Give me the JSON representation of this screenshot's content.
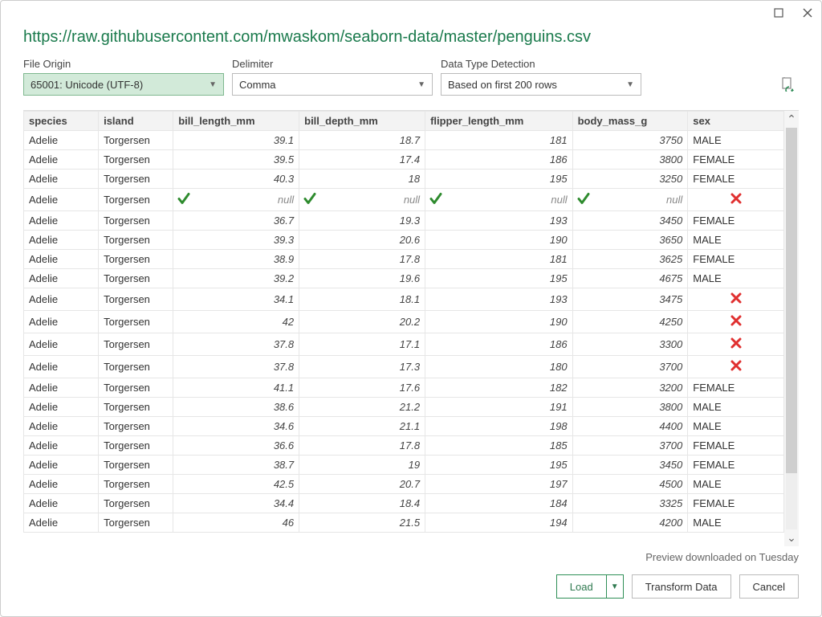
{
  "titlebar": {
    "maximize_icon": "maximize",
    "close_icon": "close"
  },
  "url": "https://raw.githubusercontent.com/mwaskom/seaborn-data/master/penguins.csv",
  "options": {
    "file_origin_label": "File Origin",
    "file_origin_value": "65001: Unicode (UTF-8)",
    "delimiter_label": "Delimiter",
    "delimiter_value": "Comma",
    "detection_label": "Data Type Detection",
    "detection_value": "Based on first 200 rows"
  },
  "columns": [
    "species",
    "island",
    "bill_length_mm",
    "bill_depth_mm",
    "flipper_length_mm",
    "body_mass_g",
    "sex"
  ],
  "null_label": "null",
  "rows": [
    {
      "species": "Adelie",
      "island": "Torgersen",
      "bill_length_mm": "39.1",
      "bill_depth_mm": "18.7",
      "flipper_length_mm": "181",
      "body_mass_g": "3750",
      "sex": "MALE",
      "marks": {}
    },
    {
      "species": "Adelie",
      "island": "Torgersen",
      "bill_length_mm": "39.5",
      "bill_depth_mm": "17.4",
      "flipper_length_mm": "186",
      "body_mass_g": "3800",
      "sex": "FEMALE",
      "marks": {}
    },
    {
      "species": "Adelie",
      "island": "Torgersen",
      "bill_length_mm": "40.3",
      "bill_depth_mm": "18",
      "flipper_length_mm": "195",
      "body_mass_g": "3250",
      "sex": "FEMALE",
      "marks": {}
    },
    {
      "species": "Adelie",
      "island": "Torgersen",
      "bill_length_mm": null,
      "bill_depth_mm": null,
      "flipper_length_mm": null,
      "body_mass_g": null,
      "sex": null,
      "marks": {
        "bill_length_mm": "check",
        "bill_depth_mm": "check",
        "flipper_length_mm": "check",
        "body_mass_g": "check",
        "sex": "x"
      }
    },
    {
      "species": "Adelie",
      "island": "Torgersen",
      "bill_length_mm": "36.7",
      "bill_depth_mm": "19.3",
      "flipper_length_mm": "193",
      "body_mass_g": "3450",
      "sex": "FEMALE",
      "marks": {}
    },
    {
      "species": "Adelie",
      "island": "Torgersen",
      "bill_length_mm": "39.3",
      "bill_depth_mm": "20.6",
      "flipper_length_mm": "190",
      "body_mass_g": "3650",
      "sex": "MALE",
      "marks": {}
    },
    {
      "species": "Adelie",
      "island": "Torgersen",
      "bill_length_mm": "38.9",
      "bill_depth_mm": "17.8",
      "flipper_length_mm": "181",
      "body_mass_g": "3625",
      "sex": "FEMALE",
      "marks": {}
    },
    {
      "species": "Adelie",
      "island": "Torgersen",
      "bill_length_mm": "39.2",
      "bill_depth_mm": "19.6",
      "flipper_length_mm": "195",
      "body_mass_g": "4675",
      "sex": "MALE",
      "marks": {}
    },
    {
      "species": "Adelie",
      "island": "Torgersen",
      "bill_length_mm": "34.1",
      "bill_depth_mm": "18.1",
      "flipper_length_mm": "193",
      "body_mass_g": "3475",
      "sex": null,
      "marks": {
        "sex": "x"
      }
    },
    {
      "species": "Adelie",
      "island": "Torgersen",
      "bill_length_mm": "42",
      "bill_depth_mm": "20.2",
      "flipper_length_mm": "190",
      "body_mass_g": "4250",
      "sex": null,
      "marks": {
        "sex": "x"
      }
    },
    {
      "species": "Adelie",
      "island": "Torgersen",
      "bill_length_mm": "37.8",
      "bill_depth_mm": "17.1",
      "flipper_length_mm": "186",
      "body_mass_g": "3300",
      "sex": null,
      "marks": {
        "sex": "x"
      }
    },
    {
      "species": "Adelie",
      "island": "Torgersen",
      "bill_length_mm": "37.8",
      "bill_depth_mm": "17.3",
      "flipper_length_mm": "180",
      "body_mass_g": "3700",
      "sex": null,
      "marks": {
        "sex": "x"
      }
    },
    {
      "species": "Adelie",
      "island": "Torgersen",
      "bill_length_mm": "41.1",
      "bill_depth_mm": "17.6",
      "flipper_length_mm": "182",
      "body_mass_g": "3200",
      "sex": "FEMALE",
      "marks": {}
    },
    {
      "species": "Adelie",
      "island": "Torgersen",
      "bill_length_mm": "38.6",
      "bill_depth_mm": "21.2",
      "flipper_length_mm": "191",
      "body_mass_g": "3800",
      "sex": "MALE",
      "marks": {}
    },
    {
      "species": "Adelie",
      "island": "Torgersen",
      "bill_length_mm": "34.6",
      "bill_depth_mm": "21.1",
      "flipper_length_mm": "198",
      "body_mass_g": "4400",
      "sex": "MALE",
      "marks": {}
    },
    {
      "species": "Adelie",
      "island": "Torgersen",
      "bill_length_mm": "36.6",
      "bill_depth_mm": "17.8",
      "flipper_length_mm": "185",
      "body_mass_g": "3700",
      "sex": "FEMALE",
      "marks": {}
    },
    {
      "species": "Adelie",
      "island": "Torgersen",
      "bill_length_mm": "38.7",
      "bill_depth_mm": "19",
      "flipper_length_mm": "195",
      "body_mass_g": "3450",
      "sex": "FEMALE",
      "marks": {}
    },
    {
      "species": "Adelie",
      "island": "Torgersen",
      "bill_length_mm": "42.5",
      "bill_depth_mm": "20.7",
      "flipper_length_mm": "197",
      "body_mass_g": "4500",
      "sex": "MALE",
      "marks": {}
    },
    {
      "species": "Adelie",
      "island": "Torgersen",
      "bill_length_mm": "34.4",
      "bill_depth_mm": "18.4",
      "flipper_length_mm": "184",
      "body_mass_g": "3325",
      "sex": "FEMALE",
      "marks": {}
    },
    {
      "species": "Adelie",
      "island": "Torgersen",
      "bill_length_mm": "46",
      "bill_depth_mm": "21.5",
      "flipper_length_mm": "194",
      "body_mass_g": "4200",
      "sex": "MALE",
      "marks": {}
    }
  ],
  "status": "Preview downloaded on Tuesday",
  "buttons": {
    "load": "Load",
    "transform": "Transform Data",
    "cancel": "Cancel"
  }
}
